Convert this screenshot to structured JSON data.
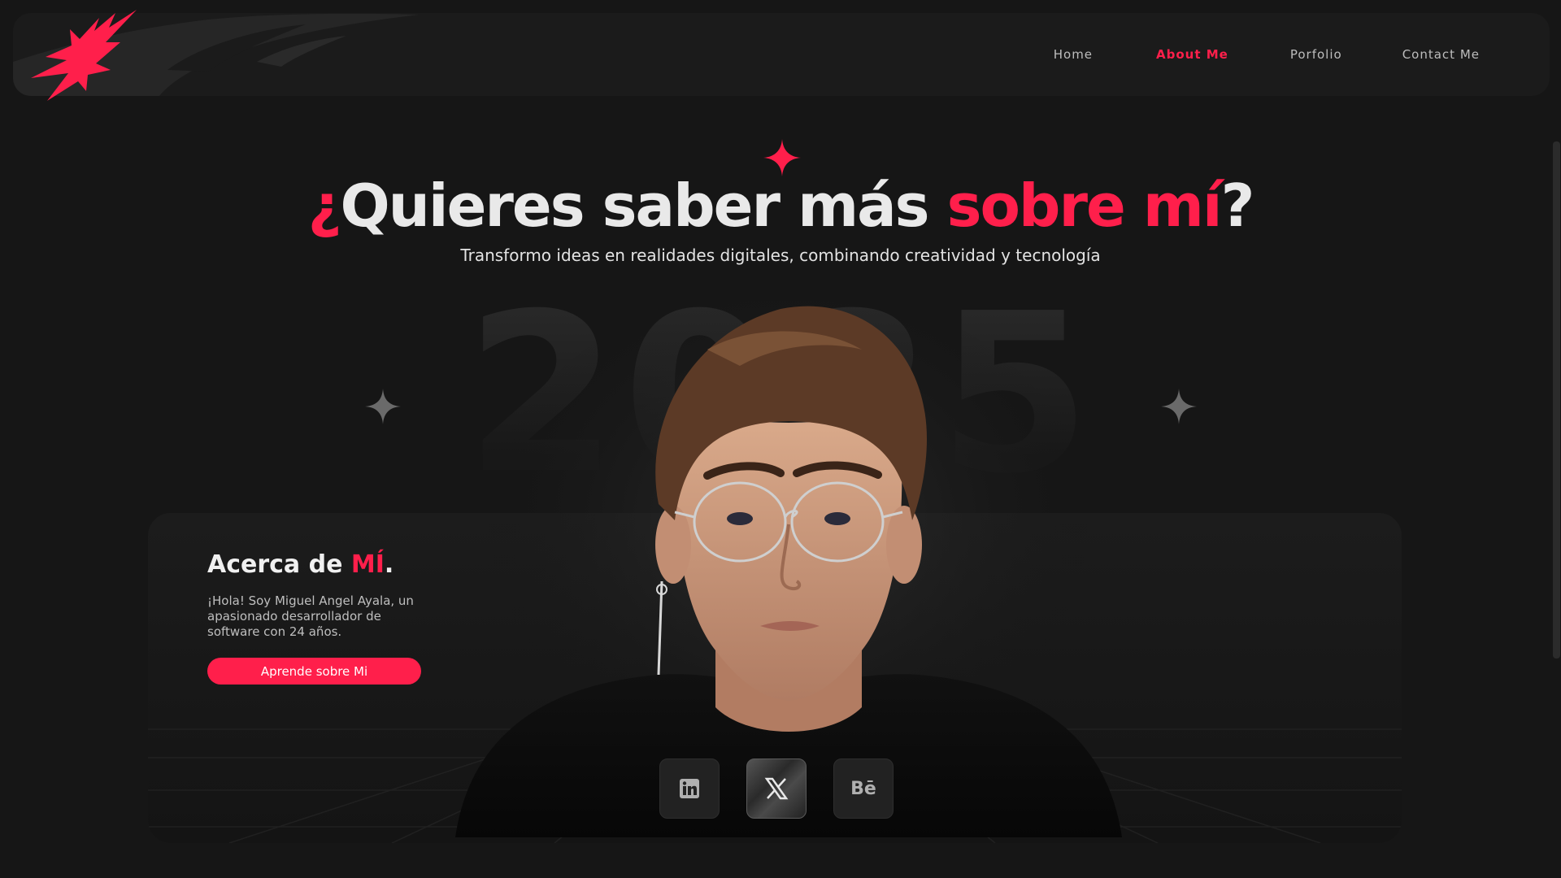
{
  "nav": {
    "links": [
      "Home",
      "About Me",
      "Porfolio",
      "Contact Me"
    ],
    "active": "About Me"
  },
  "hero": {
    "title_prefix": "¿",
    "title_main": "Quieres saber más ",
    "title_accent": "sobre mí",
    "title_suffix": "?",
    "subtitle": "Transformo ideas en realidades digitales, combinando creatividad y tecnología",
    "year_background": "2025"
  },
  "about": {
    "title_main": "Acerca de ",
    "title_accent": "MÍ",
    "title_dot": ".",
    "text": "¡Hola! Soy Miguel Angel Ayala, un apasionado desarrollador de software con 24 años.",
    "cta_label": "Aprende sobre Mi"
  },
  "social": [
    {
      "name": "linkedin-icon"
    },
    {
      "name": "x-icon"
    },
    {
      "name": "behance-icon",
      "label": "Bē"
    }
  ],
  "colors": {
    "accent": "#ff1f4b",
    "background": "#161616",
    "surface": "#1b1b1b"
  }
}
